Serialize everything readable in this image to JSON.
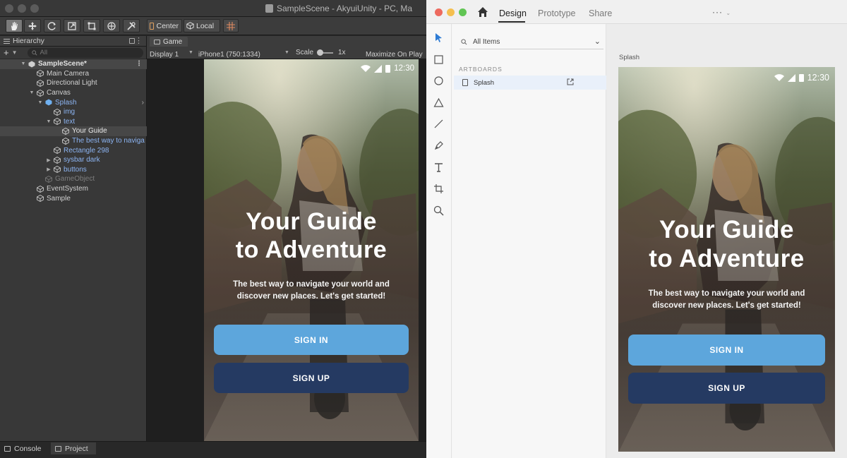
{
  "unity": {
    "window_title": "SampleScene - AkyuiUnity - PC, Ma",
    "toolbar": {
      "center_label": "Center",
      "local_label": "Local"
    },
    "hierarchy": {
      "tab_label": "Hierarchy",
      "search_placeholder": "All",
      "rows": [
        {
          "label": "SampleScene*"
        },
        {
          "label": "Main Camera"
        },
        {
          "label": "Directional Light"
        },
        {
          "label": "Canvas"
        },
        {
          "label": "Splash"
        },
        {
          "label": "img"
        },
        {
          "label": "text"
        },
        {
          "label": "Your Guide"
        },
        {
          "label": "The best way to naviga"
        },
        {
          "label": "Rectangle 298"
        },
        {
          "label": "sysbar dark"
        },
        {
          "label": "buttons"
        },
        {
          "label": "GameObject"
        },
        {
          "label": "EventSystem"
        },
        {
          "label": "Sample"
        }
      ]
    },
    "game": {
      "tab_label": "Game",
      "display": "Display 1",
      "resolution": "iPhone1 (750:1334)",
      "scale_label": "Scale",
      "scale_value": "1x",
      "maximize_label": "Maximize On Play"
    },
    "bottom_tabs": {
      "console": "Console",
      "project": "Project"
    }
  },
  "app_screen": {
    "time": "12:30",
    "headline_line1": "Your Guide",
    "headline_line2": "to Adventure",
    "subtext_line1": "The best way to navigate your world and",
    "subtext_line2": "discover new places. Let's get started!",
    "sign_in": "SIGN IN",
    "sign_up": "SIGN UP",
    "colors": {
      "sign_in_bg": "#5da6dc",
      "sign_up_bg": "#253a62"
    }
  },
  "xd": {
    "tabs": {
      "design": "Design",
      "prototype": "Prototype",
      "share": "Share"
    },
    "more": "···",
    "search_label": "All Items",
    "section_label": "ARTBOARDS",
    "artboard_item": "Splash",
    "canvas_artboard_label": "Splash"
  }
}
